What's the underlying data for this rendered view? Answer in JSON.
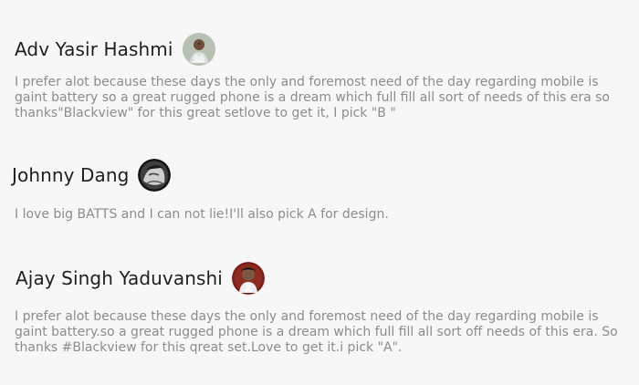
{
  "comments": [
    {
      "author": "Adv Yasir Hashmi",
      "avatar_icon": "user-avatar-photo",
      "text": "I prefer alot because these days the only and foremost need of the day regarding mobile is gaint battery so a great rugged phone is a dream which full fill all sort of needs of this era so thanks\"Blackview\" for this great setlove to get it, I pick \"B \""
    },
    {
      "author": "Johnny Dang",
      "avatar_icon": "user-avatar-photo",
      "text": "I love big BATTS and I can not lie!I'll also pick A for design."
    },
    {
      "author": "Ajay Singh Yaduvanshi",
      "avatar_icon": "user-avatar-photo",
      "text": "I prefer alot because these days the only and foremost need of the day regarding mobile is gaint battery.so a great rugged phone is a dream which full fill all sort off needs of this era. So thanks #Blackview for this qreat set.Love to get it.i pick \"A\"."
    }
  ]
}
